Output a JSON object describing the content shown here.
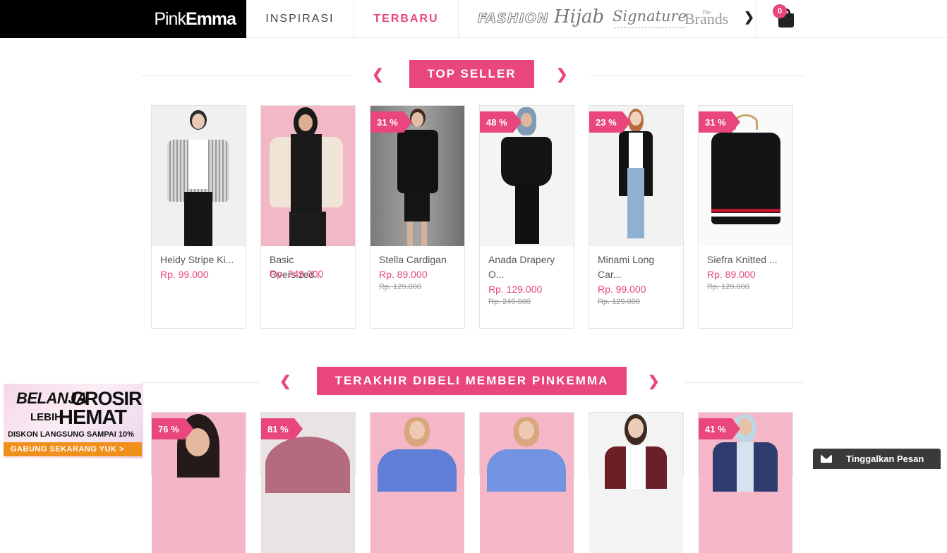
{
  "header": {
    "logo_thin": "Pink",
    "logo_bold": "Emma",
    "nav": [
      "INSPIRASI",
      "TERBARU"
    ],
    "brands": [
      "FASHION",
      "Hijab",
      "Signature",
      "The",
      "Brands"
    ],
    "next_icon": "chevron-right-icon",
    "cart_count": "0"
  },
  "sections": [
    {
      "title": "TOP SELLER",
      "products": [
        {
          "name": "Heidy Stripe Ki...",
          "price": "Rp. 99.000",
          "old_price": "",
          "discount": ""
        },
        {
          "name": "Basic Oversized...",
          "price": "Rp. 249.000",
          "old_price": "",
          "discount": ""
        },
        {
          "name": "Stella Cardigan",
          "price": "Rp. 89.000",
          "old_price": "Rp. 129.000",
          "discount": "31 %"
        },
        {
          "name": "Anada Drapery O...",
          "price": "Rp. 129.000",
          "old_price": "Rp. 249.000",
          "discount": "48 %"
        },
        {
          "name": "Minami Long Car...",
          "price": "Rp. 99.000",
          "old_price": "Rp. 129.000",
          "discount": "23 %"
        },
        {
          "name": "Siefra Knitted ...",
          "price": "Rp. 89.000",
          "old_price": "Rp. 129.000",
          "discount": "31 %"
        }
      ]
    },
    {
      "title": "TERAKHIR DIBELI MEMBER PINKEMMA",
      "products": [
        {
          "discount": "76 %"
        },
        {
          "discount": "81 %"
        },
        {
          "discount": ""
        },
        {
          "discount": ""
        },
        {
          "discount": ""
        },
        {
          "discount": "41 %"
        }
      ]
    }
  ],
  "promo": {
    "belanja": "BELANJA",
    "grosir": "GROSIR",
    "lebih": "LEBIH",
    "hemat": "HEMAT",
    "diskon": "DISKON LANGSUNG SAMPAI 10%",
    "cta": "GABUNG SEKARANG YUK >"
  },
  "chat": {
    "label": "Tinggalkan Pesan"
  },
  "colors": {
    "accent": "#e8467d",
    "promo_cta": "#f0901c",
    "chat_bg": "#3a3a3a"
  }
}
